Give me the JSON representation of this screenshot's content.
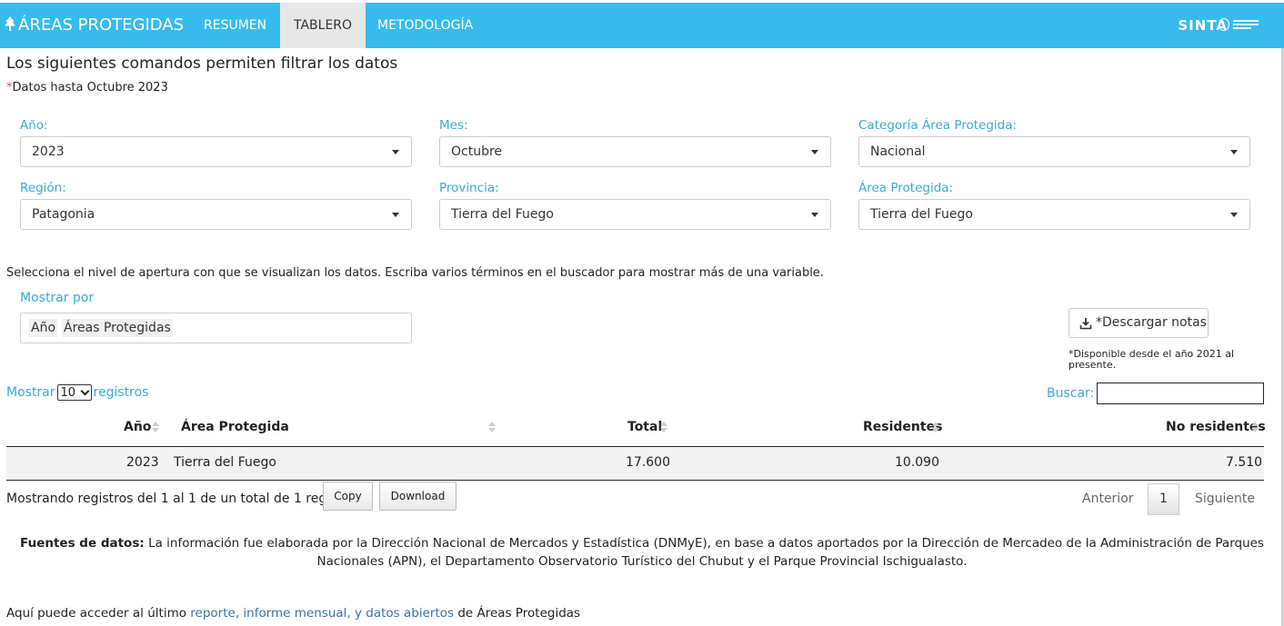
{
  "navbar": {
    "brand": "ÁREAS PROTEGIDAS",
    "items": [
      "RESUMEN",
      "TABLERO",
      "METODOLOGÍA"
    ],
    "active": "TABLERO",
    "sinta": "SINTA"
  },
  "header": {
    "title": "Los siguientes comandos permiten filtrar los datos",
    "note_star": "*",
    "note": "Datos hasta Octubre 2023"
  },
  "filters": {
    "year": {
      "label": "Año:",
      "value": "2023"
    },
    "month": {
      "label": "Mes:",
      "value": "Octubre"
    },
    "category": {
      "label": "Categoría Área Protegida:",
      "value": "Nacional"
    },
    "region": {
      "label": "Región:",
      "value": "Patagonia"
    },
    "province": {
      "label": "Provincia:",
      "value": "Tierra del Fuego"
    },
    "area": {
      "label": "Área Protegida:",
      "value": "Tierra del Fuego"
    }
  },
  "instructions": "Selecciona el nivel de apertura con que se visualizan los datos. Escriba varios términos en el buscador para mostrar más de una variable.",
  "mostrar_por": {
    "label": "Mostrar por",
    "tags": [
      "Año",
      "Áreas Protegidas"
    ]
  },
  "download_notes": {
    "label": "*Descargar notas",
    "note": "*Disponible desde el año 2021 al presente."
  },
  "table_controls": {
    "show_prefix": "Mostrar",
    "show_value": "10",
    "show_suffix": "registros",
    "search_label": "Buscar:"
  },
  "table": {
    "columns": [
      "Año",
      "Área Protegida",
      "Total",
      "Residentes",
      "No residentes"
    ],
    "rows": [
      [
        "2023",
        "Tierra del Fuego",
        "17.600",
        "10.090",
        "7.510"
      ]
    ]
  },
  "table_footer": {
    "info": "Mostrando registros del 1 al 1 de un total de 1 registros",
    "copy": "Copy",
    "download": "Download",
    "prev": "Anterior",
    "page": "1",
    "next": "Siguiente"
  },
  "sources": {
    "label": "Fuentes de datos:",
    "text": "La información fue elaborada por la Dirección Nacional de Mercados y Estadística (DNMyE), en base a datos aportados por la Dirección de Mercadeo de la Administración de Parques Nacionales (APN), el Departamento Observatorio Turístico del Chubut y el Parque Provincial Ischigualasto."
  },
  "footer": {
    "prefix": "Aquí puede acceder al último ",
    "link": "reporte, informe mensual, y datos abiertos",
    "suffix": " de Áreas Protegidas"
  }
}
